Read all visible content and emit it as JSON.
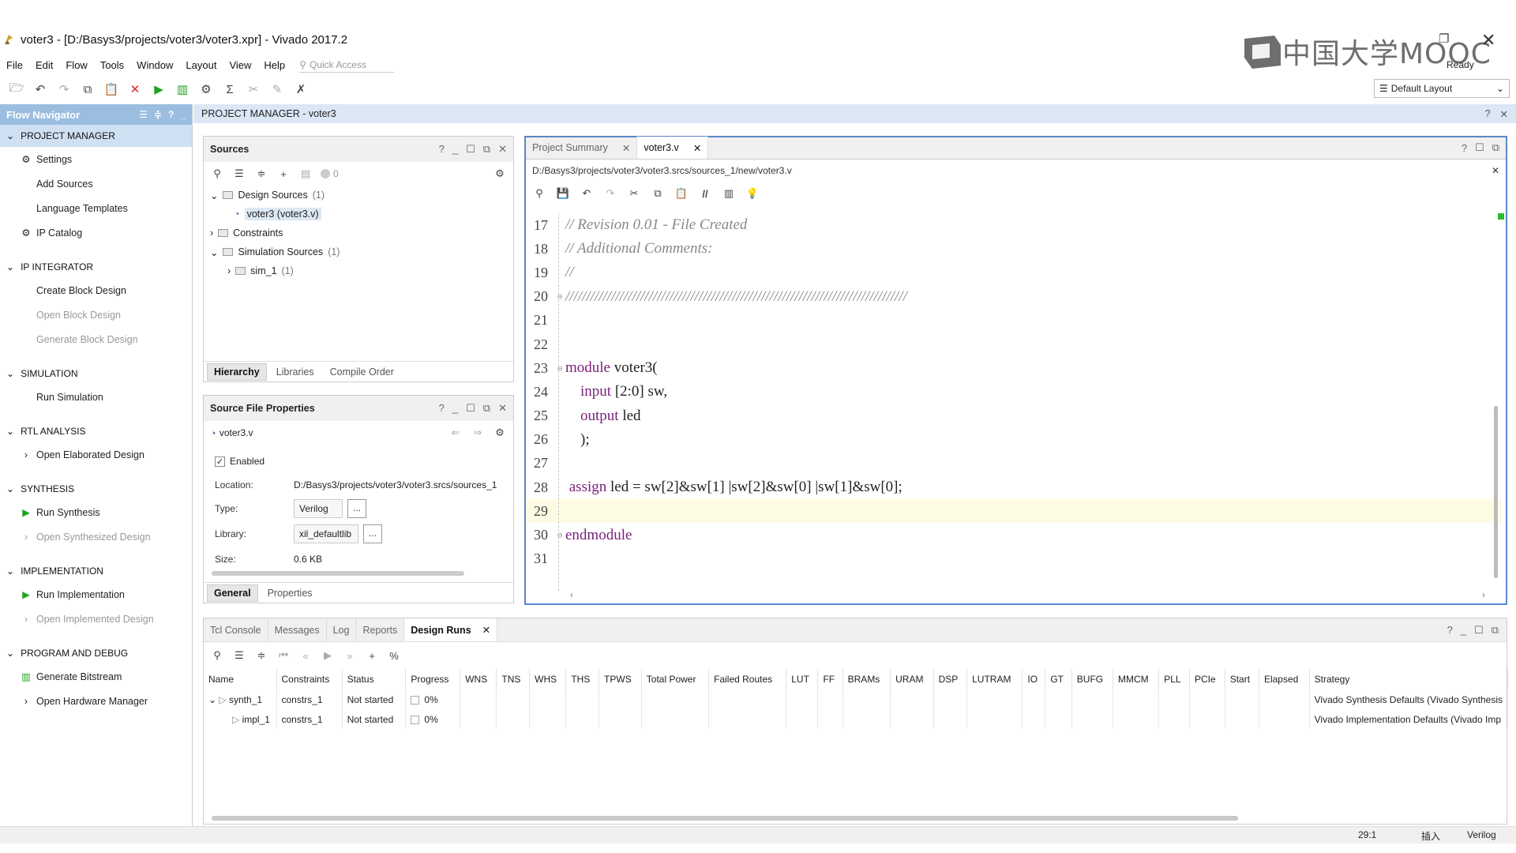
{
  "window": {
    "title": "voter3 - [D:/Basys3/projects/voter3/voter3.xpr] - Vivado 2017.2",
    "status": "Ready",
    "watermark": "中国大学MOOC"
  },
  "menu": [
    "File",
    "Edit",
    "Flow",
    "Tools",
    "Window",
    "Layout",
    "View",
    "Help"
  ],
  "quick_access_placeholder": "Quick Access",
  "layout_select": "Default Layout",
  "flow_navigator": {
    "title": "Flow Navigator",
    "sections": [
      {
        "label": "PROJECT MANAGER",
        "items": [
          "Settings",
          "Add Sources",
          "Language Templates",
          "IP Catalog"
        ]
      },
      {
        "label": "IP INTEGRATOR",
        "items": [
          "Create Block Design",
          "Open Block Design",
          "Generate Block Design"
        ]
      },
      {
        "label": "SIMULATION",
        "items": [
          "Run Simulation"
        ]
      },
      {
        "label": "RTL ANALYSIS",
        "items": [
          "Open Elaborated Design"
        ]
      },
      {
        "label": "SYNTHESIS",
        "items": [
          "Run Synthesis",
          "Open Synthesized Design"
        ]
      },
      {
        "label": "IMPLEMENTATION",
        "items": [
          "Run Implementation",
          "Open Implemented Design"
        ]
      },
      {
        "label": "PROGRAM AND DEBUG",
        "items": [
          "Generate Bitstream",
          "Open Hardware Manager"
        ]
      }
    ]
  },
  "pm_header": "PROJECT MANAGER - voter3",
  "sources": {
    "title": "Sources",
    "badge": "0",
    "tree": {
      "design": "Design Sources",
      "design_count": "(1)",
      "voter3": "voter3 (voter3.v)",
      "constraints": "Constraints",
      "sim": "Simulation Sources",
      "sim_count": "(1)",
      "sim1": "sim_1",
      "sim1_count": "(1)"
    },
    "tabs": [
      "Hierarchy",
      "Libraries",
      "Compile Order"
    ]
  },
  "source_file_properties": {
    "title": "Source File Properties",
    "file": "voter3.v",
    "enabled": "Enabled",
    "location_label": "Location:",
    "location": "D:/Basys3/projects/voter3/voter3.srcs/sources_1",
    "type_label": "Type:",
    "type": "Verilog",
    "library_label": "Library:",
    "library": "xil_defaultlib",
    "size_label": "Size:",
    "size": "0.6 KB",
    "tabs": [
      "General",
      "Properties"
    ]
  },
  "editor": {
    "tabs": [
      "Project Summary",
      "voter3.v"
    ],
    "path": "D:/Basys3/projects/voter3/voter3.srcs/sources_1/new/voter3.v",
    "lines": [
      {
        "n": "17",
        "text": "// Revision 0.01 - File Created"
      },
      {
        "n": "18",
        "text": "// Additional Comments:"
      },
      {
        "n": "19",
        "text": "//"
      },
      {
        "n": "20",
        "text": "//////////////////////////////////////////////////////////////////////////////////"
      },
      {
        "n": "21",
        "text": ""
      },
      {
        "n": "22",
        "text": ""
      },
      {
        "n": "23",
        "kw": "module",
        "text": " voter3("
      },
      {
        "n": "24",
        "kw": "    input",
        "text": " [2:0] sw,"
      },
      {
        "n": "25",
        "kw": "    output",
        "text": " led"
      },
      {
        "n": "26",
        "text": "    );"
      },
      {
        "n": "27",
        "text": ""
      },
      {
        "n": "28",
        "kw": " assign",
        "text": " led = sw[2]&sw[1] |sw[2]&sw[0] |sw[1]&sw[0];"
      },
      {
        "n": "29",
        "text": ""
      },
      {
        "n": "30",
        "kw": "endmodule",
        "text": ""
      },
      {
        "n": "31",
        "text": ""
      }
    ]
  },
  "bottom": {
    "tabs": [
      "Tcl Console",
      "Messages",
      "Log",
      "Reports",
      "Design Runs"
    ],
    "columns": [
      "Name",
      "Constraints",
      "Status",
      "Progress",
      "WNS",
      "TNS",
      "WHS",
      "THS",
      "TPWS",
      "Total Power",
      "Failed Routes",
      "LUT",
      "FF",
      "BRAMs",
      "URAM",
      "DSP",
      "LUTRAM",
      "IO",
      "GT",
      "BUFG",
      "MMCM",
      "PLL",
      "PCIe",
      "Start",
      "Elapsed",
      "Strategy"
    ],
    "rows": [
      {
        "name": "synth_1",
        "constraints": "constrs_1",
        "status": "Not started",
        "progress": "0%",
        "strategy": "Vivado Synthesis Defaults (Vivado Synthesis"
      },
      {
        "name": "impl_1",
        "constraints": "constrs_1",
        "status": "Not started",
        "progress": "0%",
        "strategy": "Vivado Implementation Defaults (Vivado Imp"
      }
    ]
  },
  "statusbar": {
    "position": "29:1",
    "mode": "插入",
    "language": "Verilog"
  }
}
